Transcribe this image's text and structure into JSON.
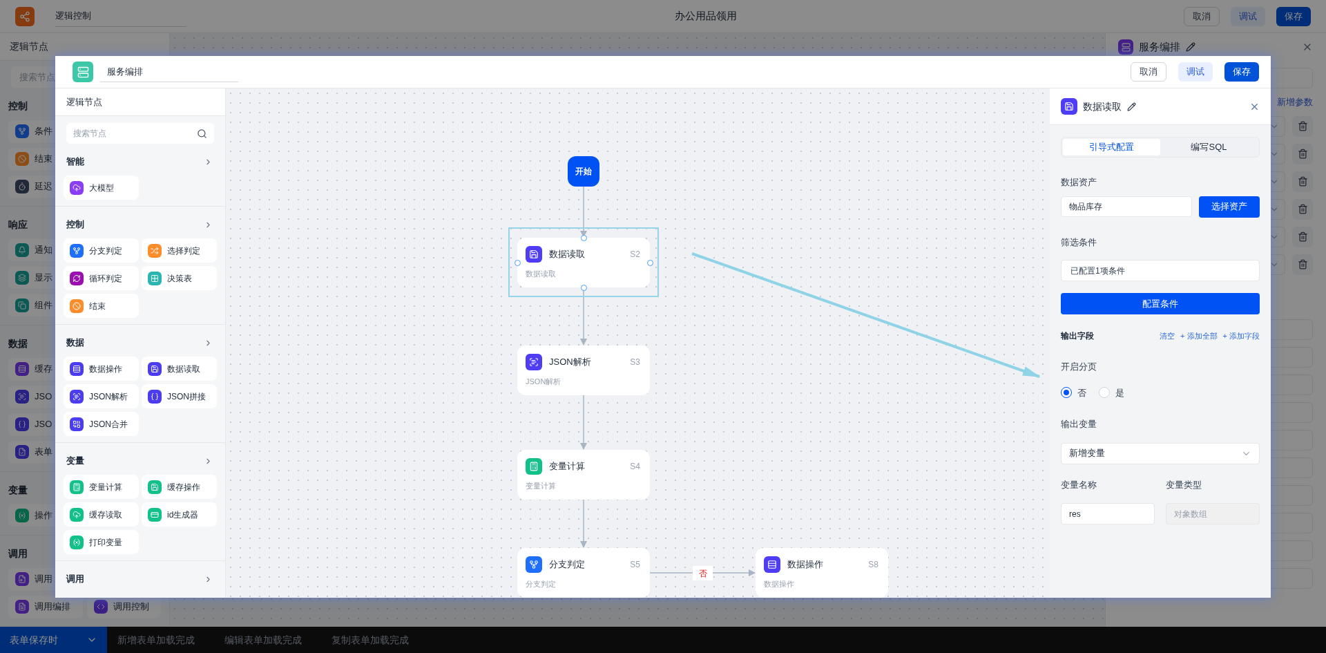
{
  "app": {
    "title": "逻辑控制",
    "page_title": "办公用品领用",
    "buttons": [
      {
        "label": "取消",
        "kind": "outline"
      },
      {
        "label": "调试",
        "kind": "soft"
      },
      {
        "label": "保存",
        "kind": "primary"
      }
    ]
  },
  "sidebar": {
    "title": "逻辑节点",
    "search": {
      "placeholder": "搜索节点"
    },
    "groups": [
      {
        "title": "控制",
        "rows": [
          [
            {
              "label": "条件",
              "kind": "branch"
            }
          ],
          [
            {
              "label": "结束",
              "kind": "end"
            }
          ],
          [
            {
              "label": "延迟",
              "kind": "delay"
            }
          ]
        ]
      },
      {
        "title": "响应",
        "rows": [
          [
            {
              "label": "通知",
              "kind": "notify"
            }
          ],
          [
            {
              "label": "显示",
              "kind": "display"
            }
          ],
          [
            {
              "label": "组件",
              "kind": "component"
            }
          ]
        ]
      },
      {
        "title": "数据",
        "rows": [
          [
            {
              "label": "缓存",
              "kind": "data_op"
            }
          ],
          [
            {
              "label": "JSO",
              "kind": "json_parse"
            }
          ],
          [
            {
              "label": "JSO",
              "kind": "json_join"
            }
          ],
          [
            {
              "label": "表单",
              "kind": "form"
            }
          ]
        ]
      },
      {
        "title": "变量",
        "rows": [
          [
            {
              "label": "操作",
              "kind": "print"
            }
          ]
        ]
      },
      {
        "title": "调用",
        "rows": [
          [
            {
              "label": "调用",
              "kind": "call_service"
            }
          ],
          [
            {
              "label": "调用编排",
              "kind": "call_flow"
            },
            {
              "label": "调用控制",
              "kind": "call_control"
            }
          ]
        ]
      }
    ]
  },
  "side_panel": {
    "title": "服务编排",
    "add_link": "新增参数"
  },
  "modal": {
    "title": "服务编排",
    "buttons": [
      {
        "label": "取消",
        "kind": "outline"
      },
      {
        "label": "调试",
        "kind": "soft"
      },
      {
        "label": "保存",
        "kind": "primary"
      }
    ],
    "palette": {
      "title": "逻辑节点",
      "search": {
        "placeholder": "搜索节点"
      },
      "groups": [
        {
          "title": "智能",
          "items": [
            {
              "label": "大模型",
              "kind": "model",
              "color": "#8b3cf7"
            }
          ]
        },
        {
          "title": "控制",
          "items": [
            {
              "label": "分支判定",
              "kind": "branch",
              "color": "#1f6fff"
            },
            {
              "label": "选择判定",
              "kind": "select",
              "color": "#ff8c2a"
            },
            {
              "label": "循环判定",
              "kind": "loop",
              "color": "#9b0fb0"
            },
            {
              "label": "决策表",
              "kind": "table",
              "color": "#2bb5b0"
            },
            {
              "label": "结束",
              "kind": "end",
              "color": "#ff8c2a"
            }
          ]
        },
        {
          "title": "数据",
          "items": [
            {
              "label": "数据操作",
              "kind": "data_op",
              "color": "#4b3cf0"
            },
            {
              "label": "数据读取",
              "kind": "data_read",
              "color": "#4b3cf0"
            },
            {
              "label": "JSON解析",
              "kind": "json_parse",
              "color": "#4b3cf0"
            },
            {
              "label": "JSON拼接",
              "kind": "json_join",
              "color": "#4b3cf0"
            },
            {
              "label": "JSON合并",
              "kind": "json_merge",
              "color": "#4b3cf0"
            }
          ]
        },
        {
          "title": "变量",
          "items": [
            {
              "label": "变量计算",
              "kind": "calc",
              "color": "#12c08a"
            },
            {
              "label": "缓存操作",
              "kind": "cache_op",
              "color": "#12c08a"
            },
            {
              "label": "缓存读取",
              "kind": "cache_read",
              "color": "#12c08a"
            },
            {
              "label": "id生成器",
              "kind": "id",
              "color": "#12c08a"
            },
            {
              "label": "打印变量",
              "kind": "print",
              "color": "#12c08a"
            }
          ]
        },
        {
          "title": "调用"
        }
      ]
    },
    "canvas": {
      "nodes": [
        {
          "kind": "start",
          "title": "开始"
        },
        {
          "kind": "data_read",
          "title": "数据读取",
          "code": "S2",
          "subtitle": "数据读取",
          "color": "#4f3cf5",
          "selected": true
        },
        {
          "kind": "json_parse",
          "title": "JSON解析",
          "code": "S3",
          "subtitle": "JSON解析",
          "color": "#4f3cf5",
          "selected": false
        },
        {
          "kind": "calc",
          "title": "变量计算",
          "code": "S4",
          "subtitle": "变量计算",
          "color": "#12c08a",
          "selected": false
        },
        {
          "kind": "branch",
          "title": "分支判定",
          "code": "S5",
          "subtitle": "分支判定",
          "color": "#1f6fff",
          "selected": false
        },
        {
          "kind": "data_op",
          "title": "数据操作",
          "code": "S8",
          "subtitle": "数据操作",
          "color": "#4f3cf5",
          "selected": false
        }
      ],
      "branch_label": "否"
    },
    "config_panel": {
      "title": "数据读取",
      "color": "#4f3cf5",
      "tabs": [
        {
          "label": "引导式配置",
          "selected": true
        },
        {
          "label": "编写SQL",
          "selected": false
        }
      ],
      "asset": {
        "label": "数据资产",
        "value": "物品库存",
        "button": "选择资产"
      },
      "filter": {
        "label": "筛选条件",
        "value": "已配置1项条件",
        "button": "配置条件"
      },
      "output_fields": {
        "label": "输出字段",
        "actions": [
          "清空",
          "+ 添加全部",
          "+ 添加字段"
        ]
      },
      "paging": {
        "label": "开启分页",
        "options": [
          {
            "label": "否",
            "selected": true
          },
          {
            "label": "是",
            "selected": false
          }
        ]
      },
      "output_variable": {
        "label": "输出变量",
        "value": "新增变量"
      },
      "variable_name": {
        "label": "变量名称",
        "value": "res"
      },
      "variable_type": {
        "label": "变量类型",
        "placeholder": "对象数组",
        "disabled": true
      }
    }
  },
  "bottom_bar": {
    "trigger": "表单保存时",
    "tabs": [
      "新增表单加载完成",
      "编辑表单加载完成",
      "复制表单加载完成"
    ]
  }
}
